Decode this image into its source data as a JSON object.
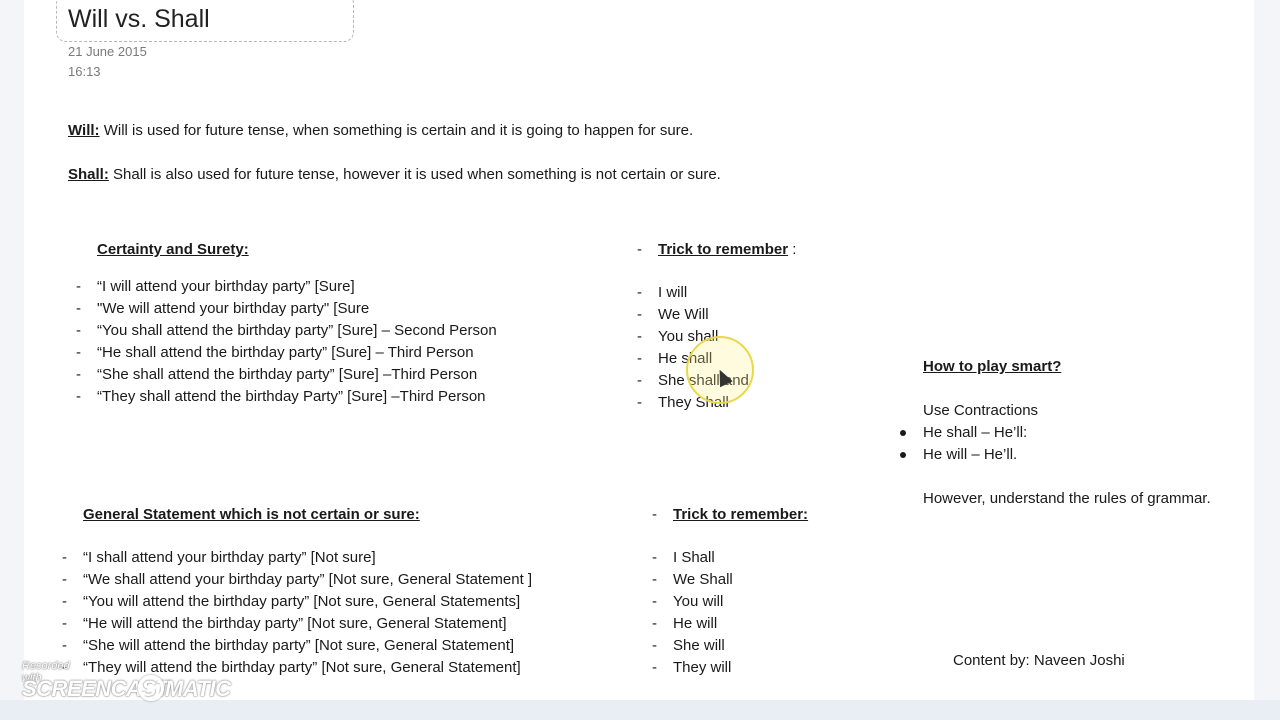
{
  "note": {
    "title": "Will vs. Shall",
    "date": "21 June 2015",
    "time": "16:13"
  },
  "definitions": {
    "will_term": "Will:",
    "will_text": " Will is used for future tense, when something is certain and it is going to happen for sure.",
    "shall_term": "Shall:",
    "shall_text": " Shall is also used for future tense, however it is used when something is not certain or sure."
  },
  "certainty": {
    "heading": "Certainty and Surety:",
    "items": [
      "“I will attend your birthday party” [Sure]",
      "\"We will attend your birthday party\" [Sure",
      "“You shall attend the birthday party” [Sure] – Second Person",
      "“He shall attend the birthday party” [Sure] – Third Person",
      "“She shall attend the birthday party” [Sure] –Third Person",
      "“They shall attend the birthday Party” [Sure] –Third Person"
    ]
  },
  "trick1": {
    "heading": "Trick to remember",
    "suffix": " :",
    "items": [
      "I will",
      "We Will",
      "You shall",
      "He shall",
      "She shall and",
      "They Shall"
    ]
  },
  "smart": {
    "heading": "How to play smart?",
    "intro": "Use Contractions",
    "bullets": [
      "He shall – He’ll:",
      "He will – He’ll."
    ],
    "outro": "However, understand the rules of grammar."
  },
  "general": {
    "heading": "General Statement which is not certain or sure:",
    "items": [
      "“I shall attend your birthday party” [Not sure]",
      "“We shall attend your birthday party” [Not sure, General Statement ]",
      "“You will attend the birthday party” [Not sure, General Statements]",
      "“He will attend the birthday party” [Not sure, General Statement]",
      "“She will attend the birthday party” [Not sure, General Statement]",
      "“They will attend the birthday party” [Not sure, General Statement]"
    ]
  },
  "trick2": {
    "heading": "Trick to remember:",
    "items": [
      "I Shall",
      "We Shall",
      "You will",
      "He will",
      "She will",
      "They will"
    ]
  },
  "credit": "Content by: Naveen Joshi",
  "watermark": {
    "line1": "Recorded with",
    "line2": "SCREENCAST",
    "line3": "MATIC"
  }
}
